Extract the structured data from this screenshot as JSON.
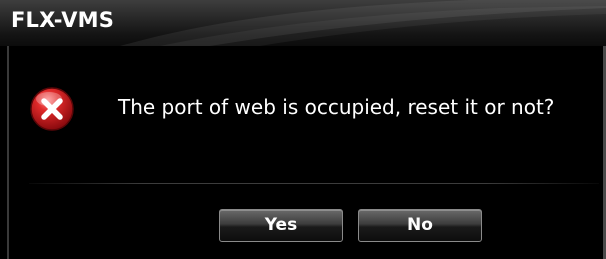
{
  "window": {
    "title": "FLX-VMS"
  },
  "dialog": {
    "icon": "error-x-icon",
    "message": "The port of web is occupied, reset it or not?",
    "buttons": {
      "yes_label": "Yes",
      "no_label": "No"
    }
  },
  "colors": {
    "background": "#000000",
    "text": "#ffffff",
    "error_icon_red": "#c0141a"
  }
}
